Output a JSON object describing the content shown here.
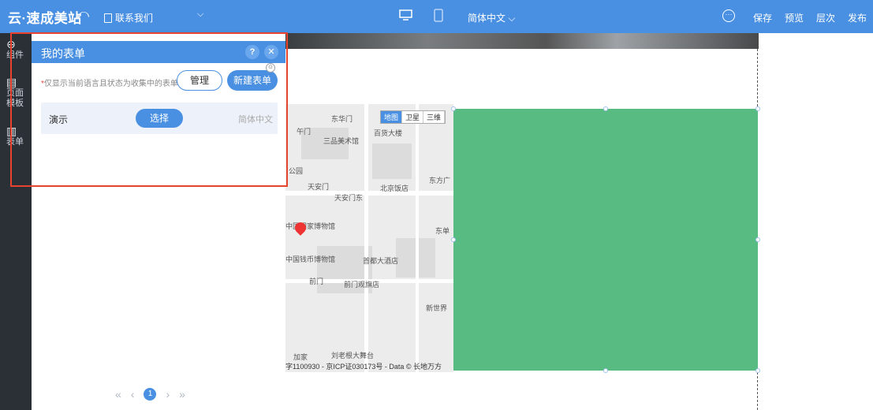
{
  "topbar": {
    "logo": "云·速成美站",
    "page_selector": "联系我们",
    "language": "简体中文 ⌵",
    "actions": {
      "save": "保存",
      "preview": "预览",
      "layers": "层次",
      "publish": "发布"
    },
    "icons": {
      "undo": "undo-icon",
      "desktop": "desktop-icon",
      "mobile": "mobile-icon",
      "more": "more-icon"
    }
  },
  "rail": {
    "items": [
      {
        "icon": "⊕",
        "label": "组件"
      },
      {
        "icon": "▤",
        "label": "页面\n模板"
      },
      {
        "icon": "▥",
        "label": "表单"
      }
    ]
  },
  "form_panel": {
    "title": "我的表单",
    "note_star": "*",
    "note": "仅显示当前语言且状态为收集中的表单",
    "manage_label": "管理",
    "new_label": "新建表单",
    "forms": [
      {
        "name": "演示",
        "select_label": "选择",
        "language": "简体中文"
      }
    ],
    "pagination": {
      "first": "«",
      "prev": "‹",
      "current": "1",
      "next": "›",
      "last": "»"
    }
  },
  "canvas": {
    "map": {
      "type_tabs": [
        "地图",
        "卫星",
        "三维"
      ],
      "active_tab": "地图",
      "labels": [
        "东华门",
        "午门",
        "三品美术馆",
        "百货大楼",
        "公园",
        "天安门",
        "北京饭店",
        "东方广",
        "天安门东",
        "中国国家博物馆",
        "东单",
        "中国钱币博物馆",
        "首都大酒店",
        "前门",
        "前门观旗店",
        "新世界",
        "刘老根大舞台",
        "加家"
      ],
      "copyright": "字1100930 - 京ICP证030173号 - Data © 长地万方"
    },
    "block_color": "#57bb82"
  },
  "colors": {
    "primary": "#4a90e2",
    "highlight": "#e8432f",
    "rail": "#2b2f36"
  }
}
